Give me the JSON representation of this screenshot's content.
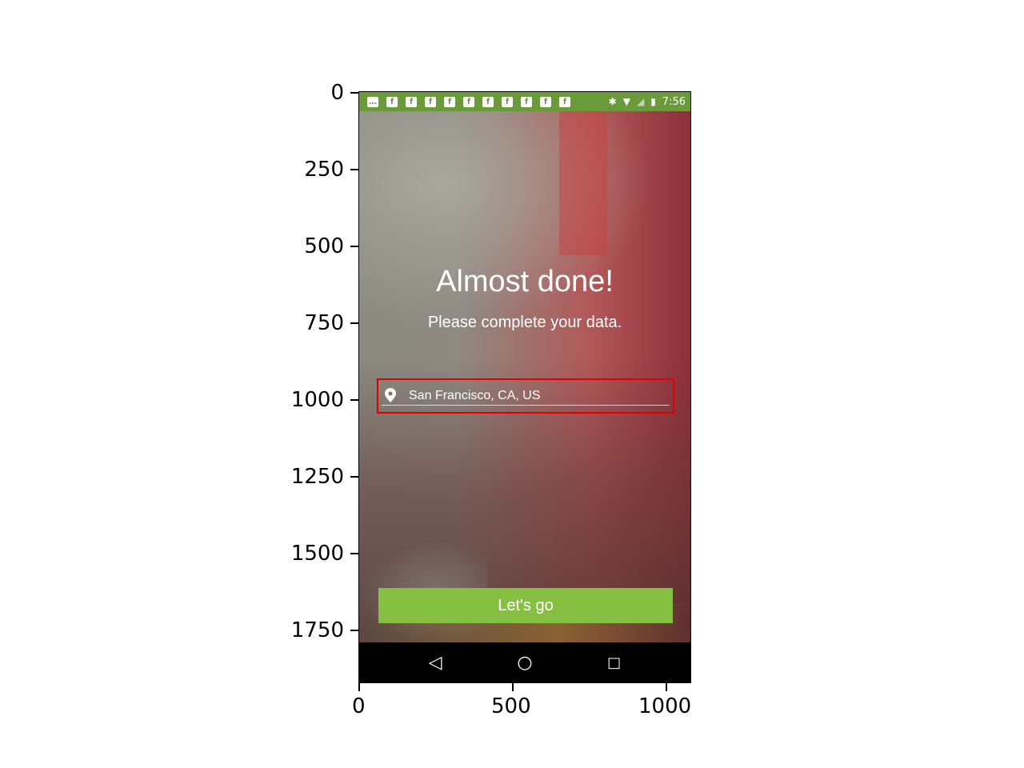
{
  "axes": {
    "y_ticks": [
      "0",
      "250",
      "500",
      "750",
      "1000",
      "1250",
      "1500",
      "1750"
    ],
    "x_ticks": [
      "0",
      "500",
      "1000"
    ]
  },
  "status_bar": {
    "time": "7:56",
    "color": "#6a9a3a",
    "notification_icons": [
      "message-icon",
      "facebook-icon",
      "facebook-icon",
      "facebook-icon",
      "facebook-icon",
      "facebook-icon",
      "facebook-icon",
      "facebook-icon",
      "facebook-icon",
      "facebook-icon",
      "facebook-icon"
    ]
  },
  "screen": {
    "title": "Almost done!",
    "subtitle": "Please complete your data.",
    "location_value": "San Francisco, CA, US",
    "button_label": "Let's go",
    "accent": "#86c042",
    "highlight_color": "#e00000"
  }
}
